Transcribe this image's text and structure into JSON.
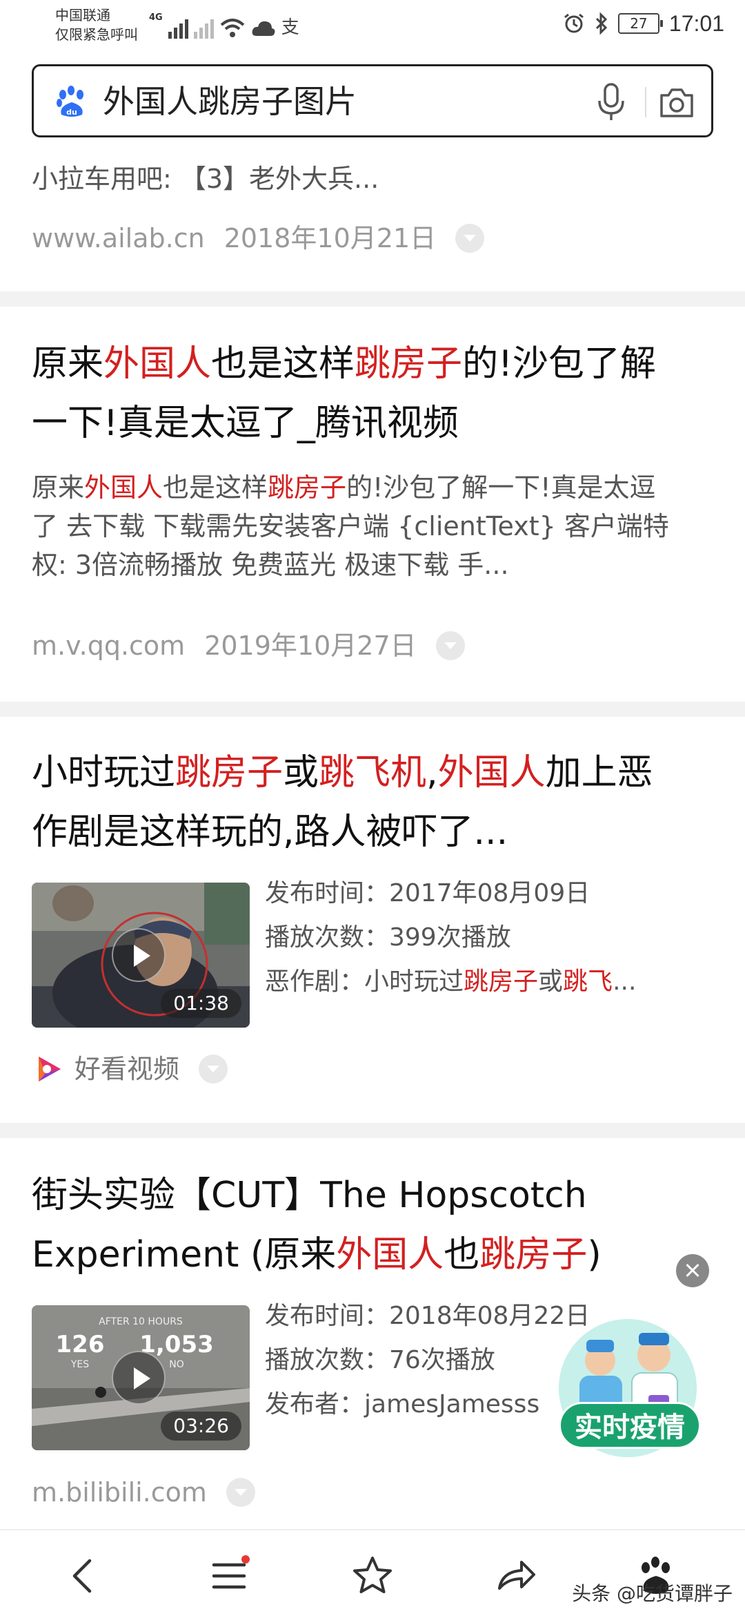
{
  "status_bar": {
    "carrier_line1": "中国联通",
    "carrier_line2": "仅限紧急呼叫",
    "network": "4G",
    "alipay_glyph": "支",
    "battery": "27",
    "time": "17:01"
  },
  "search": {
    "query": "外国人跳房子图片"
  },
  "partial_result": {
    "snippet": "小拉车用吧: 【3】老外大兵...",
    "site": "www.ailab.cn",
    "date": "2018年10月21日"
  },
  "result1": {
    "title_parts": [
      "原来",
      "外国人",
      "也是这样",
      "跳房子",
      "的!沙包了解",
      "一下!真是太逗了_腾讯视频"
    ],
    "desc_parts": [
      "原来",
      "外国人",
      "也是这样",
      "跳房子",
      "的!沙包了解一下!真是太逗",
      "了 去下载 下载需先安装客户端 {clientText} 客户端特",
      "权: 3倍流畅播放 免费蓝光 极速下载 手..."
    ],
    "site": "m.v.qq.com",
    "date": "2019年10月27日"
  },
  "result2": {
    "title_parts": [
      "小时玩过",
      "跳房子",
      "或",
      "跳飞机",
      ",",
      "外国人",
      "加上恶",
      "作剧是这样玩的,路人被吓了..."
    ],
    "duration": "01:38",
    "meta_publish": "发布时间：2017年08月09日",
    "meta_plays": "播放次数：399次播放",
    "meta_desc_parts": [
      "恶作剧：小时玩过",
      "跳房子",
      "或",
      "跳飞",
      "..."
    ],
    "source": "好看视频"
  },
  "result3": {
    "title_parts": [
      "街头实验【CUT】The Hopscotch",
      "Experiment (原来",
      "外国人",
      "也",
      "跳房子",
      ")"
    ],
    "duration": "03:26",
    "thumb_text_top": "AFTER 10 HOURS",
    "thumb_text_left": "126",
    "thumb_text_right": "1,053",
    "thumb_text_yes": "YES",
    "thumb_text_no": "NO",
    "meta_publish": "发布时间：2018年08月22日",
    "meta_plays": "播放次数：76次播放",
    "meta_author": "发布者：jamesJamesss",
    "site": "m.bilibili.com"
  },
  "epidemic_badge": {
    "label": "实时疫情"
  },
  "watermark": "头条 @吃货谭胖子",
  "colors": {
    "highlight": "#d32020",
    "badge": "#1aa26e",
    "baidu_blue": "#2f6ff5"
  }
}
